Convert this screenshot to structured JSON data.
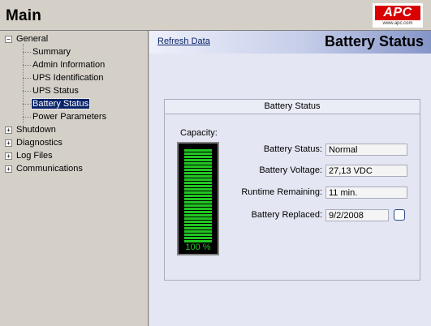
{
  "app": {
    "title": "Main",
    "logo_text": "APC",
    "logo_url": "www.apc.com"
  },
  "sidebar": {
    "tree": [
      {
        "label": "General",
        "expander": "−",
        "children": [
          {
            "label": "Summary"
          },
          {
            "label": "Admin Information"
          },
          {
            "label": "UPS Identification"
          },
          {
            "label": "UPS Status"
          },
          {
            "label": "Battery Status",
            "selected": true
          },
          {
            "label": "Power Parameters"
          }
        ]
      },
      {
        "label": "Shutdown",
        "expander": "+"
      },
      {
        "label": "Diagnostics",
        "expander": "+"
      },
      {
        "label": "Log Files",
        "expander": "+"
      },
      {
        "label": "Communications",
        "expander": "+"
      }
    ]
  },
  "main": {
    "refresh_label": "Refresh Data",
    "page_title": "Battery Status",
    "panel": {
      "title": "Battery Status",
      "capacity_label": "Capacity:",
      "capacity_text": "100 %",
      "capacity_fraction": 1.0,
      "fields": [
        {
          "label": "Battery Status:",
          "value": "Normal"
        },
        {
          "label": "Battery Voltage:",
          "value": "27,13 VDC"
        },
        {
          "label": "Runtime Remaining:",
          "value": "11 min."
        },
        {
          "label": "Battery Replaced:",
          "value": "9/2/2008"
        }
      ]
    }
  },
  "colors": {
    "meter_green": "#22c622",
    "logo_red": "#d80000",
    "selection": "#0a246a"
  }
}
